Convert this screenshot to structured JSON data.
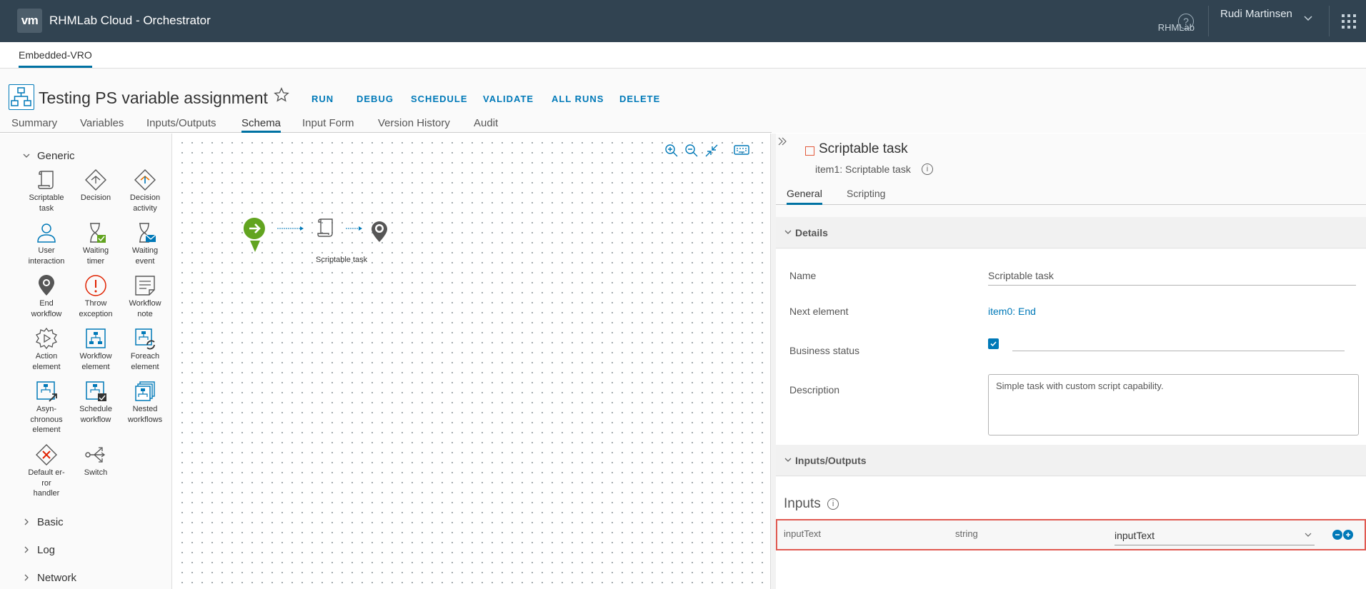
{
  "header": {
    "logo_text": "vm",
    "app_title": "RHMLab Cloud - Orchestrator",
    "help_glyph": "?",
    "user_name": "Rudi Martinsen",
    "user_org": "RHMLab"
  },
  "subnav": {
    "tab": "Embedded-VRO"
  },
  "workflow": {
    "title": "Testing PS variable assignment",
    "actions": [
      "RUN",
      "DEBUG",
      "SCHEDULE",
      "VALIDATE",
      "ALL RUNS",
      "DELETE"
    ],
    "tabs": [
      "Summary",
      "Variables",
      "Inputs/Outputs",
      "Schema",
      "Input Form",
      "Version History",
      "Audit"
    ],
    "active_tab": "Schema"
  },
  "palette": {
    "groups": {
      "generic": "Generic",
      "basic": "Basic",
      "log": "Log",
      "network": "Network"
    },
    "items": [
      [
        "Scriptable",
        "task"
      ],
      [
        "Decision",
        ""
      ],
      [
        "Decision",
        "activity"
      ],
      [
        "User",
        "interaction"
      ],
      [
        "Waiting",
        "timer"
      ],
      [
        "Waiting",
        "event"
      ],
      [
        "End",
        "workflow"
      ],
      [
        "Throw",
        "exception"
      ],
      [
        "Workflow",
        "note"
      ],
      [
        "Action",
        "element"
      ],
      [
        "Workflow",
        "element"
      ],
      [
        "Foreach",
        "element"
      ],
      [
        "Asyn-",
        "chronous",
        "element"
      ],
      [
        "Schedule",
        "workflow"
      ],
      [
        "Nested",
        "workflows"
      ],
      [
        "Default er-",
        "ror",
        "handler"
      ],
      [
        "Switch"
      ]
    ]
  },
  "canvas": {
    "node_label": "Scriptable task"
  },
  "panel": {
    "title": "Scriptable task",
    "subtitle": "item1: Scriptable task",
    "tabs": [
      "General",
      "Scripting"
    ],
    "details_header": "Details",
    "fields": {
      "name_label": "Name",
      "name_value": "Scriptable task",
      "next_label": "Next element",
      "next_value": "item0: End",
      "business_label": "Business status",
      "business_checked": true,
      "description_label": "Description",
      "description_value": "Simple task with custom script capability."
    },
    "io_header": "Inputs/Outputs",
    "inputs_title": "Inputs",
    "input_row": {
      "name": "inputText",
      "type": "string",
      "binding": "inputText"
    }
  }
}
